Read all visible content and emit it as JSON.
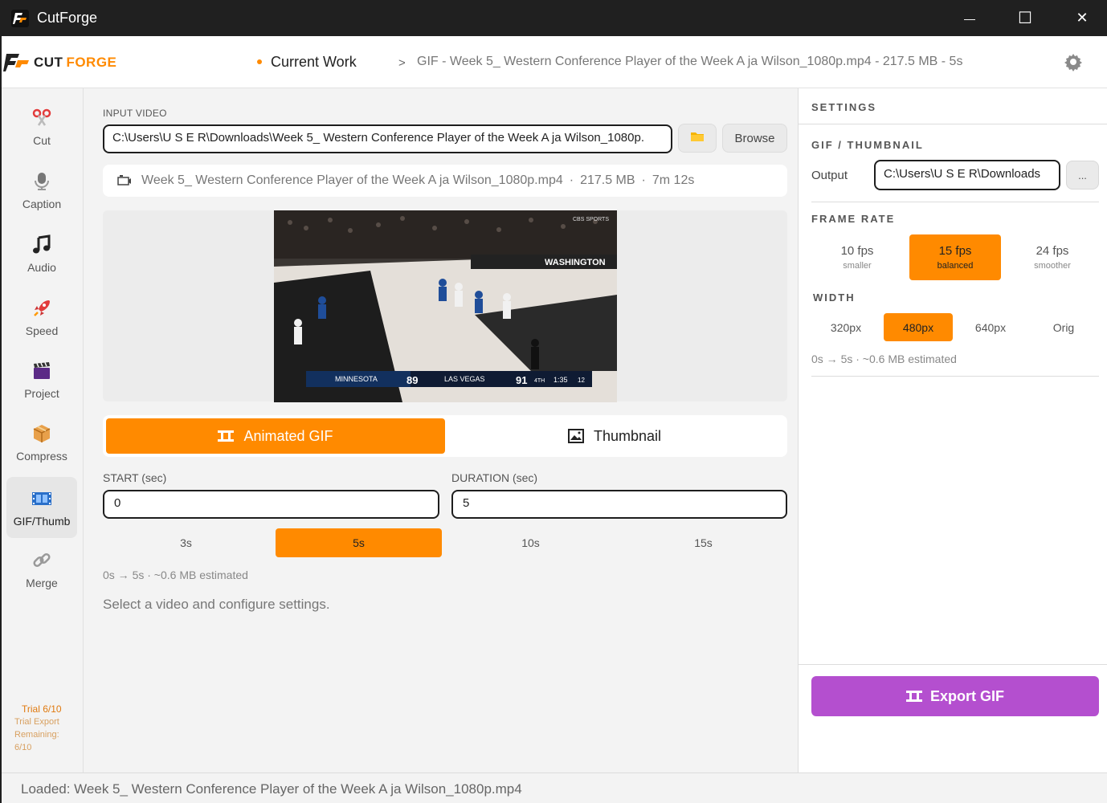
{
  "window": {
    "title": "CutForge",
    "minimize": "—",
    "maximize": "☐",
    "close": "✕"
  },
  "header": {
    "logo_word1": "CUT",
    "logo_word2": "FORGE",
    "crumb_current": "Current Work",
    "crumb_sep": ">",
    "crumb_path": "GIF - Week 5_ Western Conference Player of the Week A ja Wilson_1080p.mp4 - 217.5 MB - 5s",
    "settings_icon": "gear-icon"
  },
  "sidebar": {
    "items": [
      {
        "label": "Cut",
        "icon": "scissors-icon"
      },
      {
        "label": "Caption",
        "icon": "microphone-icon"
      },
      {
        "label": "Audio",
        "icon": "music-note-icon"
      },
      {
        "label": "Speed",
        "icon": "rocket-icon"
      },
      {
        "label": "Project",
        "icon": "clapperboard-icon"
      },
      {
        "label": "Compress",
        "icon": "package-icon"
      },
      {
        "label": "GIF/Thumb",
        "icon": "film-icon"
      },
      {
        "label": "Merge",
        "icon": "link-icon"
      }
    ],
    "active": "GIF/Thumb",
    "trial_title": "Trial 6/10",
    "trial_line": "Trial Export Remaining: 6/10"
  },
  "main": {
    "input_label": "INPUT VIDEO",
    "input_path": "C:\\Users\\U S E R\\Downloads\\Week 5_ Western Conference Player of the Week A ja Wilson_1080p.",
    "browse_label": "Browse",
    "file_name": "Week 5_ Western Conference Player of the Week A ja Wilson_1080p.mp4",
    "file_size": "217.5 MB",
    "file_duration": "7m 12s",
    "dot": "·",
    "video": {
      "team1": "MINNESOTA",
      "score1": "89",
      "team2": "LAS VEGAS",
      "score2": "91",
      "quarter": "4TH",
      "clock": "1:35",
      "shot_clock": "12",
      "banner": "WASHINGTON",
      "network": "CBS SPORTS"
    },
    "mode_gif": "Animated GIF",
    "mode_thumb": "Thumbnail",
    "start_label": "START (sec)",
    "start_value": "0",
    "duration_label": "DURATION (sec)",
    "duration_value": "5",
    "presets": [
      "3s",
      "5s",
      "10s",
      "15s"
    ],
    "preset_selected": "5s",
    "estimate": "0s → 5s  ·  ~0.6 MB estimated",
    "status_message": "Select a video and configure settings."
  },
  "settings": {
    "title": "SETTINGS",
    "section_gif": "GIF / THUMBNAIL",
    "output_label": "Output",
    "output_path": "C:\\Users\\U S E R\\Downloads",
    "output_more": "...",
    "frame_rate_title": "FRAME RATE",
    "fps_options": [
      {
        "label": "10 fps",
        "sub": "smaller"
      },
      {
        "label": "15 fps",
        "sub": "balanced"
      },
      {
        "label": "24 fps",
        "sub": "smoother"
      }
    ],
    "fps_selected": "15 fps",
    "width_title": "WIDTH",
    "width_options": [
      "320px",
      "480px",
      "640px",
      "Orig"
    ],
    "width_selected": "480px",
    "estimate": "0s → 5s  ·  ~0.6 MB estimated",
    "export_label": "Export GIF"
  },
  "statusbar": {
    "text": "Loaded: Week 5_ Western Conference Player of the Week A ja Wilson_1080p.mp4"
  },
  "colors": {
    "accent": "#ff8a00",
    "export": "#b44fcf",
    "titlebar": "#202020"
  }
}
